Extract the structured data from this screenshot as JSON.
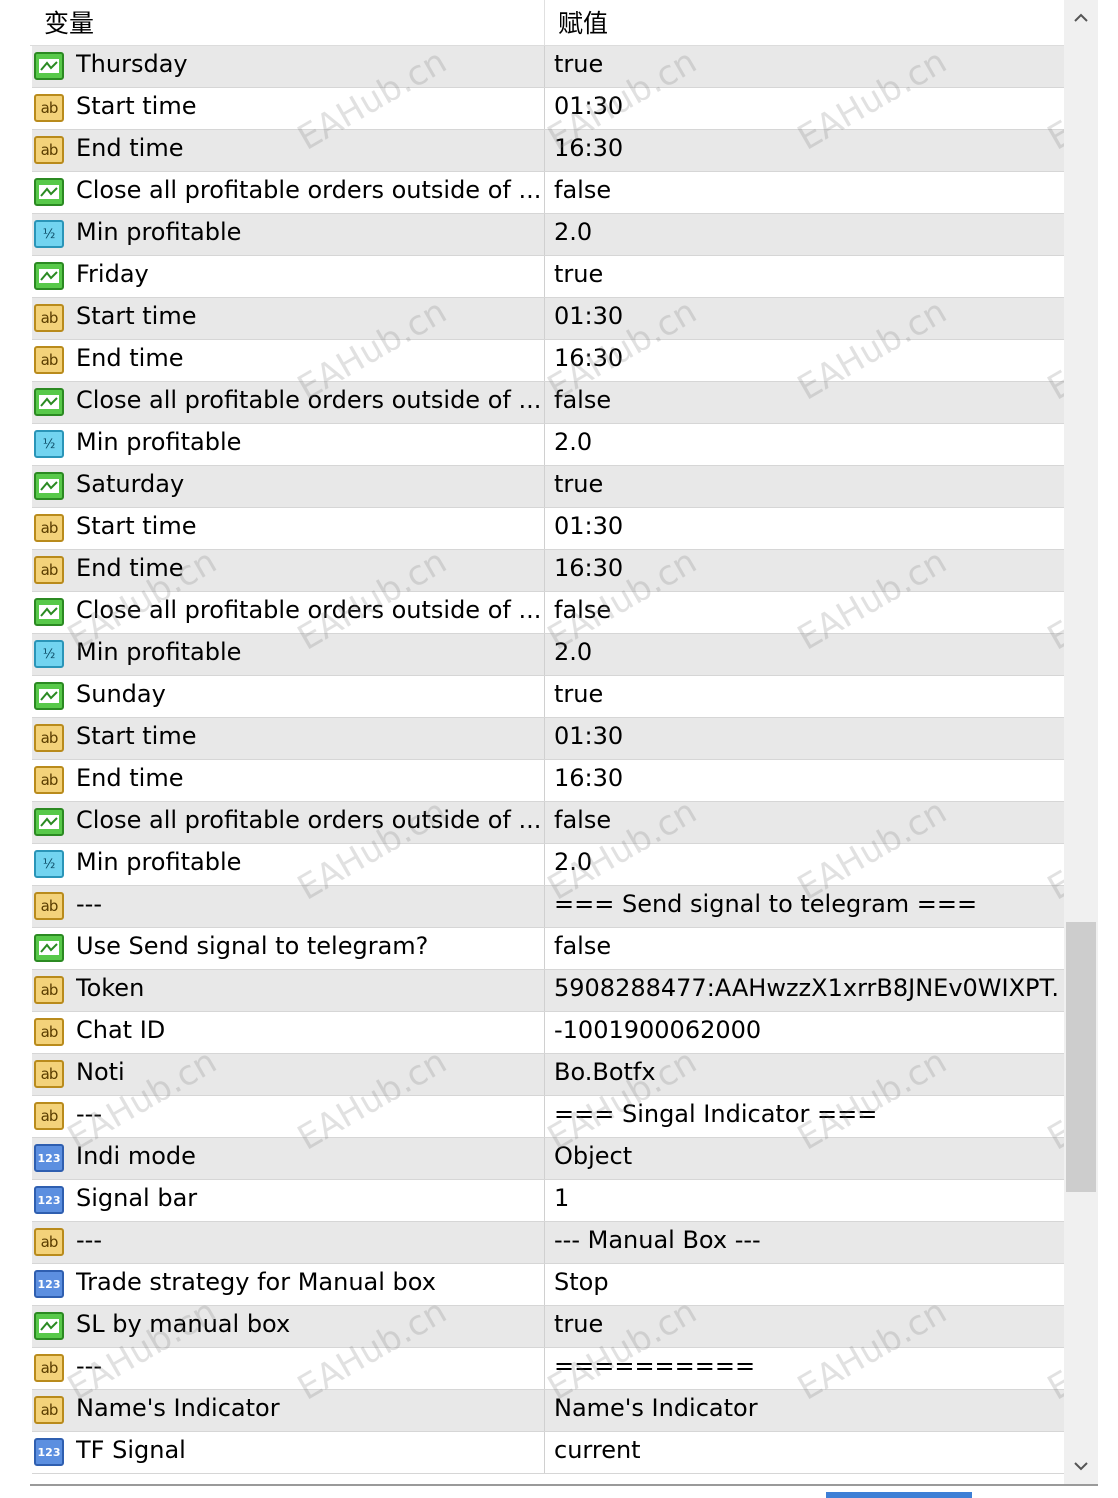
{
  "header": {
    "col_variable": "变量",
    "col_value": "赋值"
  },
  "watermark": "EAHub.cn",
  "rows": [
    {
      "icon": "bool",
      "name": "Thursday",
      "value": "true"
    },
    {
      "icon": "ab",
      "name": "Start time",
      "value": "01:30"
    },
    {
      "icon": "ab",
      "name": "End time",
      "value": "16:30"
    },
    {
      "icon": "bool",
      "name": "Close all profitable orders outside of ...",
      "value": "false"
    },
    {
      "icon": "dbl",
      "name": "Min profitable",
      "value": "2.0"
    },
    {
      "icon": "bool",
      "name": "Friday",
      "value": "true"
    },
    {
      "icon": "ab",
      "name": "Start time",
      "value": "01:30"
    },
    {
      "icon": "ab",
      "name": "End time",
      "value": "16:30"
    },
    {
      "icon": "bool",
      "name": "Close all profitable orders outside of ...",
      "value": "false"
    },
    {
      "icon": "dbl",
      "name": "Min profitable",
      "value": "2.0"
    },
    {
      "icon": "bool",
      "name": "Saturday",
      "value": "true"
    },
    {
      "icon": "ab",
      "name": "Start time",
      "value": "01:30"
    },
    {
      "icon": "ab",
      "name": "End time",
      "value": "16:30"
    },
    {
      "icon": "bool",
      "name": "Close all profitable orders outside of ...",
      "value": "false"
    },
    {
      "icon": "dbl",
      "name": "Min profitable",
      "value": "2.0"
    },
    {
      "icon": "bool",
      "name": "Sunday",
      "value": "true"
    },
    {
      "icon": "ab",
      "name": "Start time",
      "value": "01:30"
    },
    {
      "icon": "ab",
      "name": "End time",
      "value": "16:30"
    },
    {
      "icon": "bool",
      "name": "Close all profitable orders outside of ...",
      "value": "false"
    },
    {
      "icon": "dbl",
      "name": "Min profitable",
      "value": "2.0"
    },
    {
      "icon": "ab",
      "name": "---",
      "value": "=== Send signal to telegram ==="
    },
    {
      "icon": "bool",
      "name": "Use Send signal to telegram?",
      "value": "false"
    },
    {
      "icon": "ab",
      "name": "Token",
      "value": "5908288477:AAHwzzX1xrrB8JNEv0WIXPT..."
    },
    {
      "icon": "ab",
      "name": "Chat ID",
      "value": "-1001900062000"
    },
    {
      "icon": "ab",
      "name": "Noti",
      "value": "Bo.Botfx"
    },
    {
      "icon": "ab",
      "name": "---",
      "value": "=== Singal Indicator ==="
    },
    {
      "icon": "num",
      "name": "Indi mode",
      "value": "Object"
    },
    {
      "icon": "num",
      "name": "Signal bar",
      "value": "1"
    },
    {
      "icon": "ab",
      "name": "---",
      "value": "--- Manual Box ---"
    },
    {
      "icon": "num",
      "name": "Trade strategy for Manual box",
      "value": "Stop"
    },
    {
      "icon": "bool",
      "name": "SL by manual box",
      "value": "true"
    },
    {
      "icon": "ab",
      "name": "---",
      "value": "=========="
    },
    {
      "icon": "ab",
      "name": "Name's Indicator",
      "value": "Name's Indicator"
    },
    {
      "icon": "num",
      "name": "TF Signal",
      "value": "current"
    }
  ],
  "icon_labels": {
    "ab": "ab",
    "dbl": "½",
    "num": "123"
  },
  "colors": {
    "row_alt": "#e8e8e8",
    "row": "#ffffff",
    "scroll_thumb": "#cdcdcd"
  }
}
